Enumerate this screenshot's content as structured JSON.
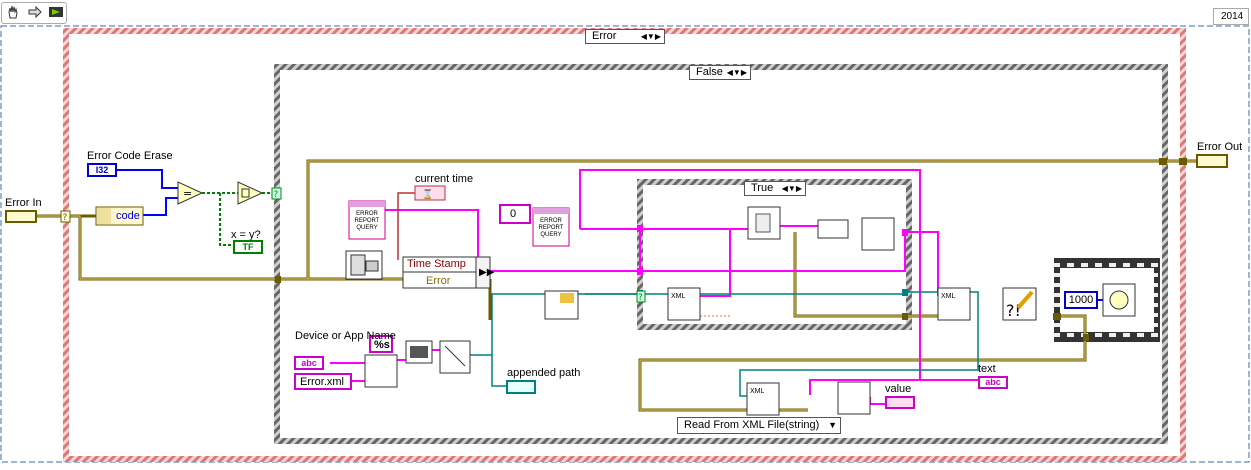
{
  "window": {
    "version_label": "2014"
  },
  "toolbar": {
    "run_icon": "hand-icon",
    "step_icon": "arrow-right-icon",
    "highlight_icon": "bulb-icon"
  },
  "outer_case": {
    "selector_label": "Error"
  },
  "inner_case": {
    "selector_label": "False"
  },
  "nested_case": {
    "selector_label": "True"
  },
  "terminals": {
    "error_in": "Error In",
    "error_out": "Error Out",
    "error_code_erase": "Error Code Erase",
    "i32_badge": "I32",
    "code_label": "code",
    "x_eq_y": "x = y?",
    "tf_badge": "TF",
    "current_time": "current time",
    "device_or_app_name": "Device or App Name",
    "format_spec": "%s",
    "error_xml": "Error.xml",
    "appended_path": "appended path",
    "text": "text",
    "value": "value",
    "abc_badge": "abc",
    "numeric_zero": "0",
    "loop_delay": "1000"
  },
  "functions": {
    "timestamp_label": "Time Stamp",
    "error_label": "Error",
    "error_report_line1": "ERROR",
    "error_report_line2": "REPORT",
    "error_report_line3": "QUERY",
    "xml_label": "XML",
    "read_from_xml": "Read From XML File(string)"
  },
  "colors": {
    "error_cluster": "#6b5b00",
    "string_wire": "#ff00ff",
    "numeric_wire": "#0000ff",
    "boolean_wire": "#008000",
    "path_wire": "#008080",
    "case_border": "#c44"
  }
}
